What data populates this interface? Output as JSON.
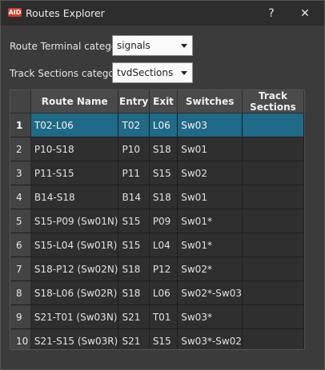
{
  "window": {
    "icon_text": "AID",
    "title": "Routes Explorer",
    "help_label": "?",
    "close_label": "✕"
  },
  "filters": {
    "route_terminal_label": "Route Terminal category",
    "route_terminal_value": "signals",
    "track_sections_label": "Track Sections category",
    "track_sections_value": "tvdSections"
  },
  "table": {
    "headers": [
      "Route Name",
      "Entry",
      "Exit",
      "Switches",
      "Track Sections"
    ],
    "selected_row": 1,
    "rows": [
      {
        "num": "1",
        "name": "T02-L06",
        "entry": "T02",
        "exit": "L06",
        "switches": "Sw03",
        "tracks": ""
      },
      {
        "num": "2",
        "name": "P10-S18",
        "entry": "P10",
        "exit": "S18",
        "switches": "Sw01",
        "tracks": ""
      },
      {
        "num": "3",
        "name": "P11-S15",
        "entry": "P11",
        "exit": "S15",
        "switches": "Sw02",
        "tracks": ""
      },
      {
        "num": "4",
        "name": "B14-S18",
        "entry": "B14",
        "exit": "S18",
        "switches": "Sw01",
        "tracks": ""
      },
      {
        "num": "5",
        "name": "S15-P09 (Sw01N)",
        "entry": "S15",
        "exit": "P09",
        "switches": "Sw01*",
        "tracks": ""
      },
      {
        "num": "6",
        "name": "S15-L04 (Sw01R)",
        "entry": "S15",
        "exit": "L04",
        "switches": "Sw01*",
        "tracks": ""
      },
      {
        "num": "7",
        "name": "S18-P12 (Sw02N)",
        "entry": "S18",
        "exit": "P12",
        "switches": "Sw02*",
        "tracks": ""
      },
      {
        "num": "8",
        "name": "S18-L06 (Sw02R)",
        "entry": "S18",
        "exit": "L06",
        "switches": "Sw02*-Sw03",
        "tracks": ""
      },
      {
        "num": "9",
        "name": "S21-T01 (Sw03N)",
        "entry": "S21",
        "exit": "T01",
        "switches": "Sw03*",
        "tracks": ""
      },
      {
        "num": "10",
        "name": "S21-S15 (Sw03R)",
        "entry": "S21",
        "exit": "S15",
        "switches": "Sw03*-Sw02",
        "tracks": ""
      }
    ]
  },
  "colors": {
    "selection": "#1f6a86",
    "icon": "#d23b2a"
  }
}
